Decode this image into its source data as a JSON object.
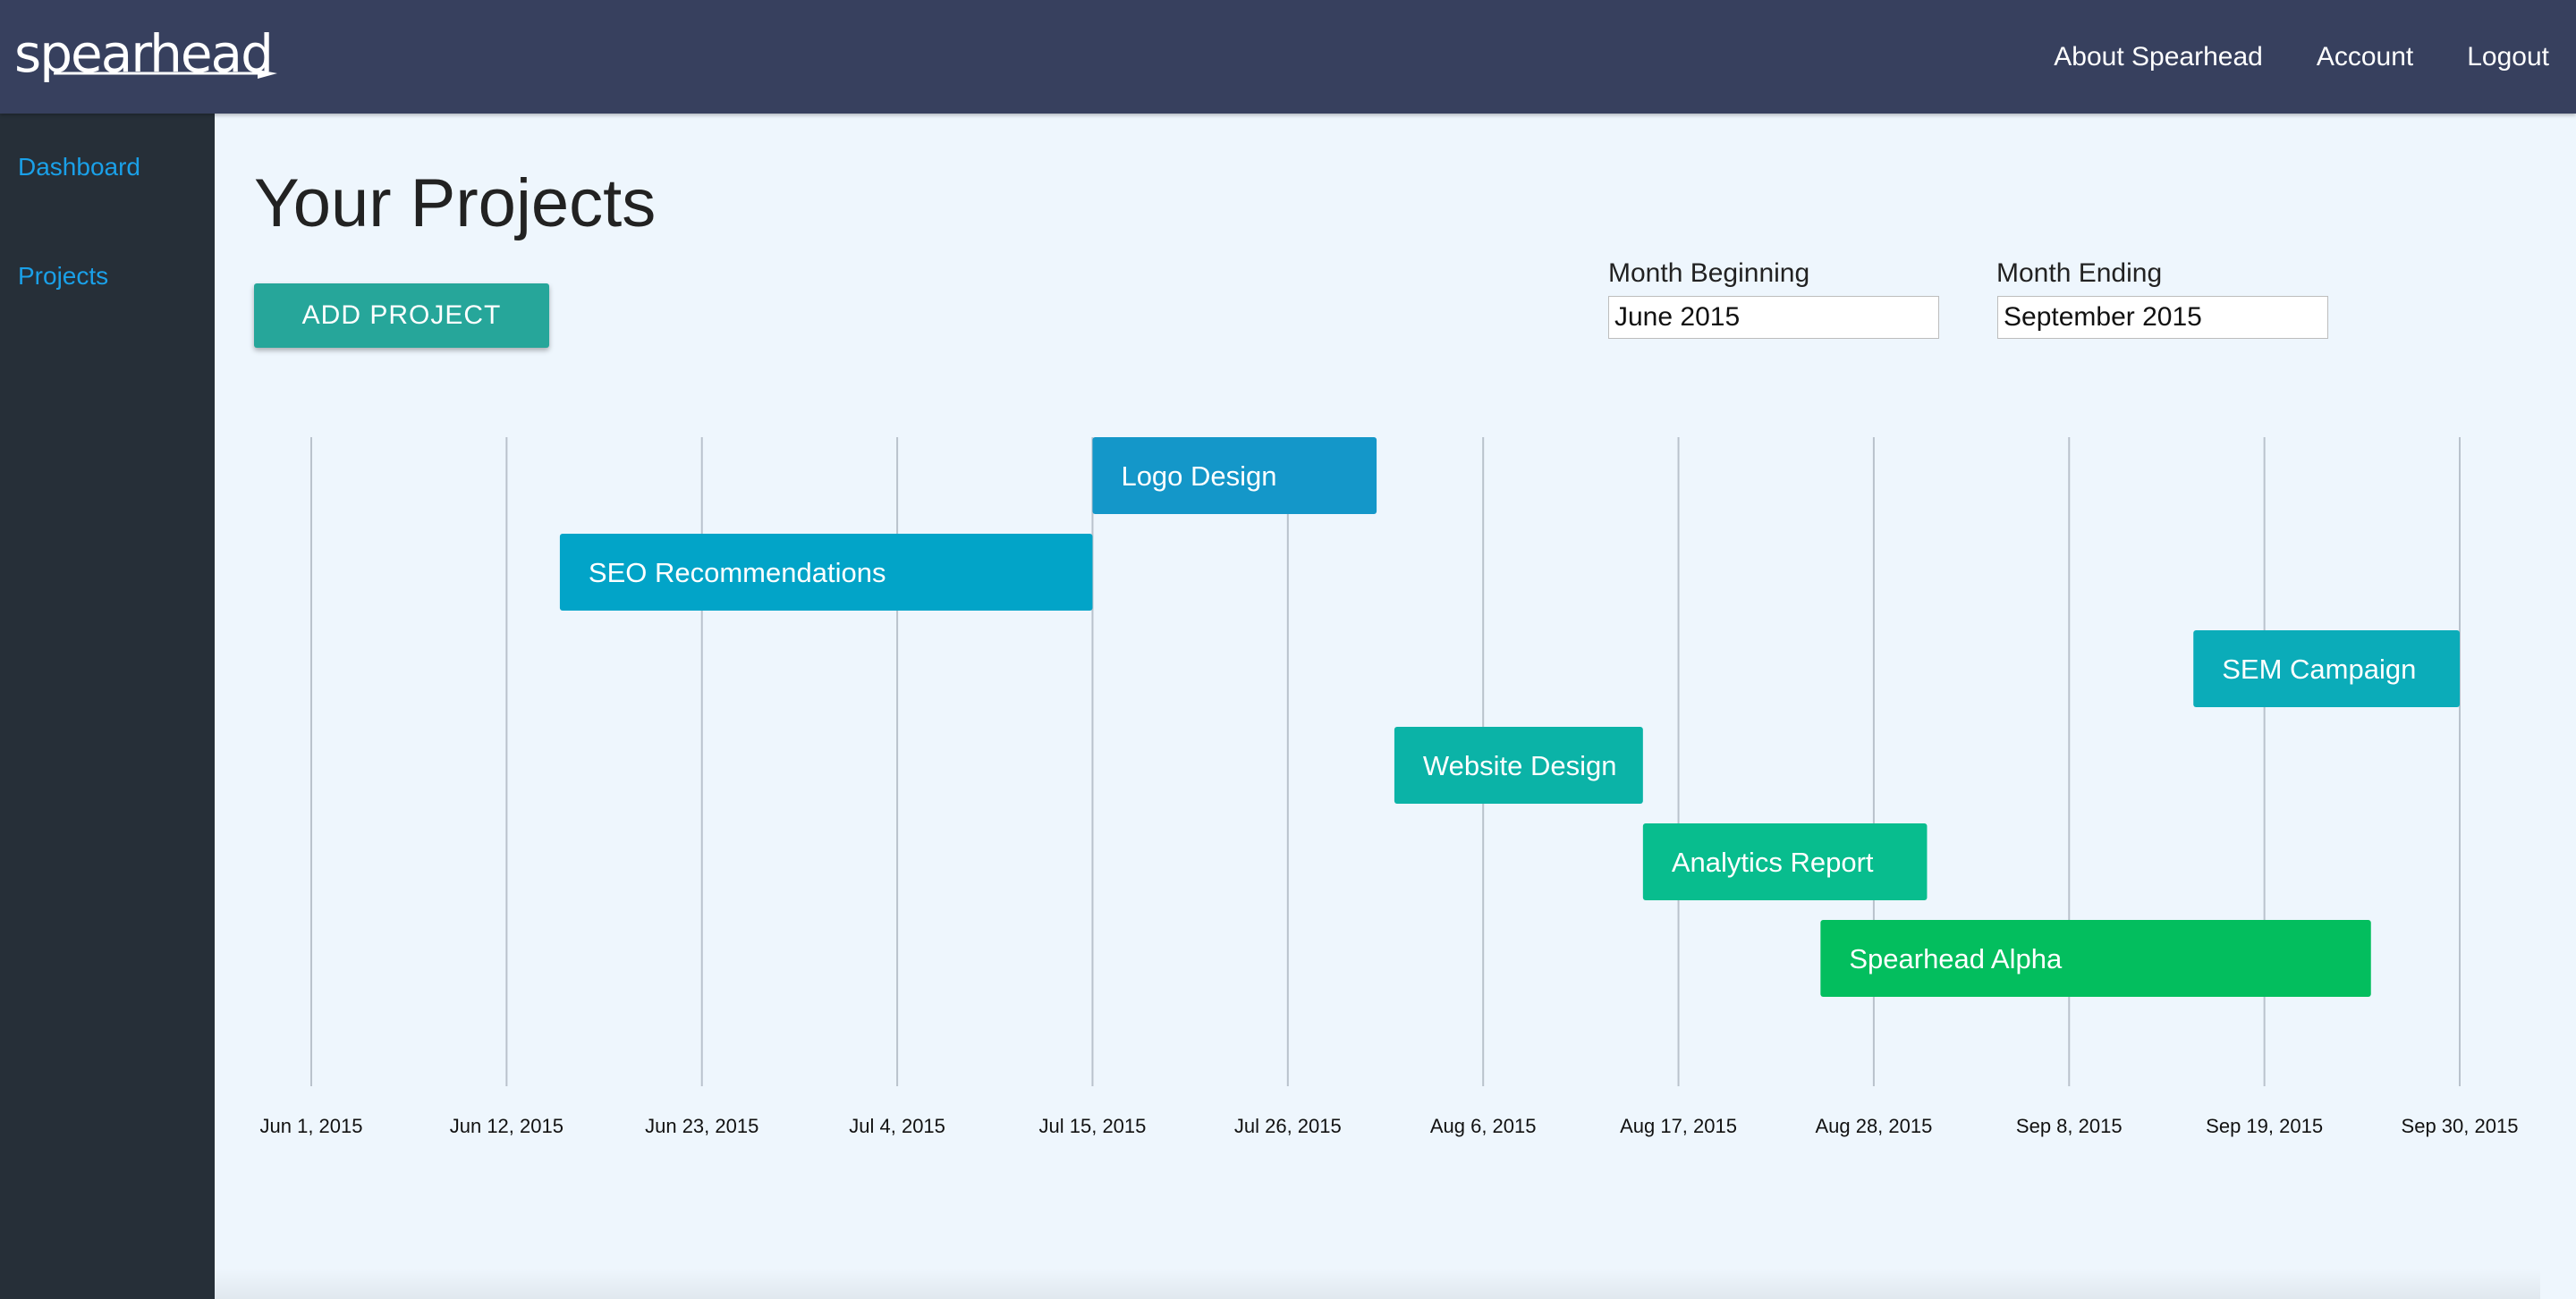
{
  "app": {
    "logo_text": "spearhead"
  },
  "nav": {
    "about": "About Spearhead",
    "account": "Account",
    "logout": "Logout"
  },
  "sidebar": {
    "items": [
      {
        "label": "Dashboard"
      },
      {
        "label": "Projects"
      }
    ]
  },
  "page": {
    "title": "Your Projects",
    "add_button": "ADD PROJECT"
  },
  "filters": {
    "begin_label": "Month Beginning",
    "begin_value": "June 2015",
    "end_label": "Month Ending",
    "end_value": "September 2015"
  },
  "colors": {
    "topbar": "#37405e",
    "sidebar": "#262f38",
    "link": "#1aa0e8",
    "add_button": "#26a69a"
  },
  "chart_data": {
    "type": "gantt",
    "x_ticks": [
      "Jun 1, 2015",
      "Jun 12, 2015",
      "Jun 23, 2015",
      "Jul 4, 2015",
      "Jul 15, 2015",
      "Jul 26, 2015",
      "Aug 6, 2015",
      "Aug 17, 2015",
      "Aug 28, 2015",
      "Sep 8, 2015",
      "Sep 19, 2015",
      "Sep 30, 2015"
    ],
    "xlim": [
      "2015-06-01",
      "2015-09-30"
    ],
    "grid": true,
    "tasks": [
      {
        "name": "Logo Design",
        "start": "2015-07-15",
        "end": "2015-07-31",
        "row": 0,
        "color": "#1497c9"
      },
      {
        "name": "SEO Recommendations",
        "start": "2015-06-15",
        "end": "2015-07-15",
        "row": 1,
        "color": "#02a4c8"
      },
      {
        "name": "SEM Campaign",
        "start": "2015-09-15",
        "end": "2015-09-30",
        "row": 2,
        "color": "#0bacb9"
      },
      {
        "name": "Website Design",
        "start": "2015-08-01",
        "end": "2015-08-15",
        "row": 3,
        "color": "#0bb3a7"
      },
      {
        "name": "Analytics Report",
        "start": "2015-08-15",
        "end": "2015-08-31",
        "row": 4,
        "color": "#08bd8e"
      },
      {
        "name": "Spearhead Alpha",
        "start": "2015-08-25",
        "end": "2015-09-25",
        "row": 5,
        "color": "#03be5e"
      }
    ]
  }
}
